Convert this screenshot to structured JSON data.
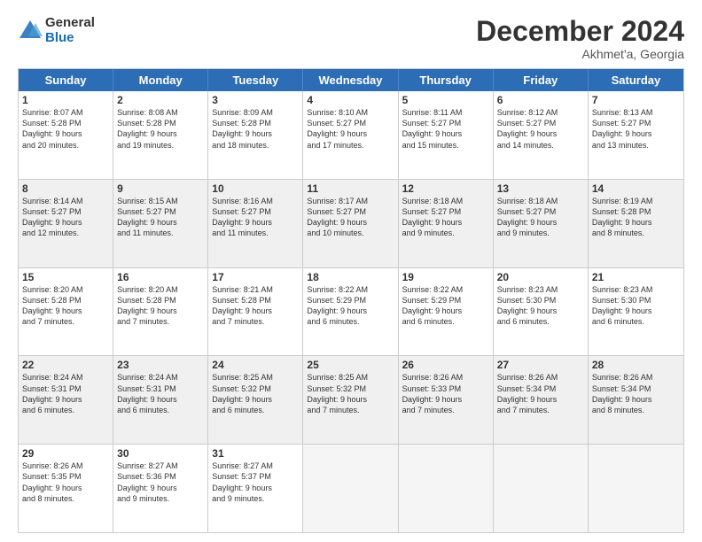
{
  "header": {
    "logo_line1": "General",
    "logo_line2": "Blue",
    "month_title": "December 2024",
    "location": "Akhmet'a, Georgia"
  },
  "days_of_week": [
    "Sunday",
    "Monday",
    "Tuesday",
    "Wednesday",
    "Thursday",
    "Friday",
    "Saturday"
  ],
  "rows": [
    [
      {
        "day": "1",
        "text": "Sunrise: 8:07 AM\nSunset: 5:28 PM\nDaylight: 9 hours\nand 20 minutes.",
        "shaded": false,
        "empty": false
      },
      {
        "day": "2",
        "text": "Sunrise: 8:08 AM\nSunset: 5:28 PM\nDaylight: 9 hours\nand 19 minutes.",
        "shaded": false,
        "empty": false
      },
      {
        "day": "3",
        "text": "Sunrise: 8:09 AM\nSunset: 5:28 PM\nDaylight: 9 hours\nand 18 minutes.",
        "shaded": false,
        "empty": false
      },
      {
        "day": "4",
        "text": "Sunrise: 8:10 AM\nSunset: 5:27 PM\nDaylight: 9 hours\nand 17 minutes.",
        "shaded": false,
        "empty": false
      },
      {
        "day": "5",
        "text": "Sunrise: 8:11 AM\nSunset: 5:27 PM\nDaylight: 9 hours\nand 15 minutes.",
        "shaded": false,
        "empty": false
      },
      {
        "day": "6",
        "text": "Sunrise: 8:12 AM\nSunset: 5:27 PM\nDaylight: 9 hours\nand 14 minutes.",
        "shaded": false,
        "empty": false
      },
      {
        "day": "7",
        "text": "Sunrise: 8:13 AM\nSunset: 5:27 PM\nDaylight: 9 hours\nand 13 minutes.",
        "shaded": false,
        "empty": false
      }
    ],
    [
      {
        "day": "8",
        "text": "Sunrise: 8:14 AM\nSunset: 5:27 PM\nDaylight: 9 hours\nand 12 minutes.",
        "shaded": true,
        "empty": false
      },
      {
        "day": "9",
        "text": "Sunrise: 8:15 AM\nSunset: 5:27 PM\nDaylight: 9 hours\nand 11 minutes.",
        "shaded": true,
        "empty": false
      },
      {
        "day": "10",
        "text": "Sunrise: 8:16 AM\nSunset: 5:27 PM\nDaylight: 9 hours\nand 11 minutes.",
        "shaded": true,
        "empty": false
      },
      {
        "day": "11",
        "text": "Sunrise: 8:17 AM\nSunset: 5:27 PM\nDaylight: 9 hours\nand 10 minutes.",
        "shaded": true,
        "empty": false
      },
      {
        "day": "12",
        "text": "Sunrise: 8:18 AM\nSunset: 5:27 PM\nDaylight: 9 hours\nand 9 minutes.",
        "shaded": true,
        "empty": false
      },
      {
        "day": "13",
        "text": "Sunrise: 8:18 AM\nSunset: 5:27 PM\nDaylight: 9 hours\nand 9 minutes.",
        "shaded": true,
        "empty": false
      },
      {
        "day": "14",
        "text": "Sunrise: 8:19 AM\nSunset: 5:28 PM\nDaylight: 9 hours\nand 8 minutes.",
        "shaded": true,
        "empty": false
      }
    ],
    [
      {
        "day": "15",
        "text": "Sunrise: 8:20 AM\nSunset: 5:28 PM\nDaylight: 9 hours\nand 7 minutes.",
        "shaded": false,
        "empty": false
      },
      {
        "day": "16",
        "text": "Sunrise: 8:20 AM\nSunset: 5:28 PM\nDaylight: 9 hours\nand 7 minutes.",
        "shaded": false,
        "empty": false
      },
      {
        "day": "17",
        "text": "Sunrise: 8:21 AM\nSunset: 5:28 PM\nDaylight: 9 hours\nand 7 minutes.",
        "shaded": false,
        "empty": false
      },
      {
        "day": "18",
        "text": "Sunrise: 8:22 AM\nSunset: 5:29 PM\nDaylight: 9 hours\nand 6 minutes.",
        "shaded": false,
        "empty": false
      },
      {
        "day": "19",
        "text": "Sunrise: 8:22 AM\nSunset: 5:29 PM\nDaylight: 9 hours\nand 6 minutes.",
        "shaded": false,
        "empty": false
      },
      {
        "day": "20",
        "text": "Sunrise: 8:23 AM\nSunset: 5:30 PM\nDaylight: 9 hours\nand 6 minutes.",
        "shaded": false,
        "empty": false
      },
      {
        "day": "21",
        "text": "Sunrise: 8:23 AM\nSunset: 5:30 PM\nDaylight: 9 hours\nand 6 minutes.",
        "shaded": false,
        "empty": false
      }
    ],
    [
      {
        "day": "22",
        "text": "Sunrise: 8:24 AM\nSunset: 5:31 PM\nDaylight: 9 hours\nand 6 minutes.",
        "shaded": true,
        "empty": false
      },
      {
        "day": "23",
        "text": "Sunrise: 8:24 AM\nSunset: 5:31 PM\nDaylight: 9 hours\nand 6 minutes.",
        "shaded": true,
        "empty": false
      },
      {
        "day": "24",
        "text": "Sunrise: 8:25 AM\nSunset: 5:32 PM\nDaylight: 9 hours\nand 6 minutes.",
        "shaded": true,
        "empty": false
      },
      {
        "day": "25",
        "text": "Sunrise: 8:25 AM\nSunset: 5:32 PM\nDaylight: 9 hours\nand 7 minutes.",
        "shaded": true,
        "empty": false
      },
      {
        "day": "26",
        "text": "Sunrise: 8:26 AM\nSunset: 5:33 PM\nDaylight: 9 hours\nand 7 minutes.",
        "shaded": true,
        "empty": false
      },
      {
        "day": "27",
        "text": "Sunrise: 8:26 AM\nSunset: 5:34 PM\nDaylight: 9 hours\nand 7 minutes.",
        "shaded": true,
        "empty": false
      },
      {
        "day": "28",
        "text": "Sunrise: 8:26 AM\nSunset: 5:34 PM\nDaylight: 9 hours\nand 8 minutes.",
        "shaded": true,
        "empty": false
      }
    ],
    [
      {
        "day": "29",
        "text": "Sunrise: 8:26 AM\nSunset: 5:35 PM\nDaylight: 9 hours\nand 8 minutes.",
        "shaded": false,
        "empty": false
      },
      {
        "day": "30",
        "text": "Sunrise: 8:27 AM\nSunset: 5:36 PM\nDaylight: 9 hours\nand 9 minutes.",
        "shaded": false,
        "empty": false
      },
      {
        "day": "31",
        "text": "Sunrise: 8:27 AM\nSunset: 5:37 PM\nDaylight: 9 hours\nand 9 minutes.",
        "shaded": false,
        "empty": false
      },
      {
        "day": "",
        "text": "",
        "shaded": false,
        "empty": true
      },
      {
        "day": "",
        "text": "",
        "shaded": false,
        "empty": true
      },
      {
        "day": "",
        "text": "",
        "shaded": false,
        "empty": true
      },
      {
        "day": "",
        "text": "",
        "shaded": false,
        "empty": true
      }
    ]
  ]
}
